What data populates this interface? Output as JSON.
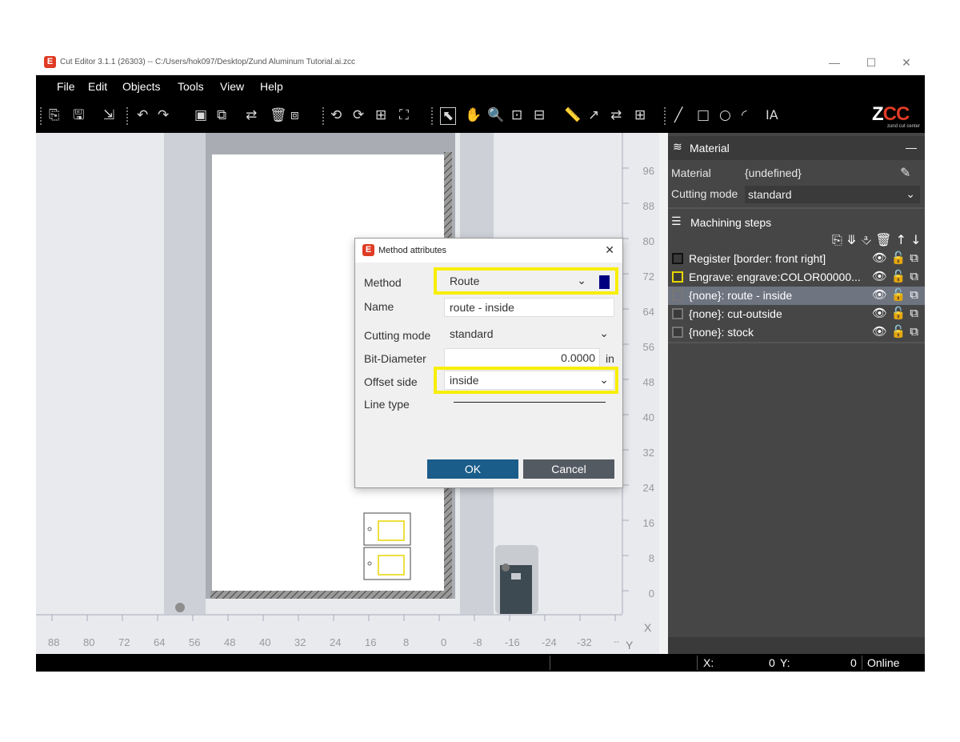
{
  "window": {
    "icon_letter": "E",
    "title": "Cut Editor 3.1.1 (26303)  --  C:/Users/hok097/Desktop/Zund Aluminum Tutorial.ai.zcc",
    "minimize": "—",
    "maximize": "☐",
    "close": "✕"
  },
  "menu": [
    "File",
    "Edit",
    "Objects",
    "Tools",
    "View",
    "Help"
  ],
  "toolbar": {
    "logo": "ZCC",
    "logo_sub": "zund cut center",
    "tools": [
      {
        "name": "import-icon",
        "glyph": "⎘"
      },
      {
        "name": "save-icon",
        "glyph": "🖫"
      },
      {
        "name": "export-icon",
        "glyph": "⇲"
      },
      {
        "name": "undo-icon",
        "glyph": "↶"
      },
      {
        "name": "redo-icon",
        "glyph": "↷"
      },
      {
        "name": "group-icon",
        "glyph": "▣"
      },
      {
        "name": "ungroup-icon",
        "glyph": "⧉"
      },
      {
        "name": "mirror-icon",
        "glyph": "⇄"
      },
      {
        "name": "delete-icon",
        "glyph": "🗑"
      },
      {
        "name": "duplicate-icon",
        "glyph": "⧈"
      },
      {
        "name": "rotate-icon",
        "glyph": "⟲"
      },
      {
        "name": "node-icon",
        "glyph": "⟳"
      },
      {
        "name": "arrange-icon",
        "glyph": "⊞"
      },
      {
        "name": "fit-icon",
        "glyph": "⛶"
      },
      {
        "name": "pointer-icon",
        "glyph": "⬉"
      },
      {
        "name": "hand-icon",
        "glyph": "✋"
      },
      {
        "name": "zoom-icon",
        "glyph": "🔍"
      },
      {
        "name": "zoom-fit-icon",
        "glyph": "⊡"
      },
      {
        "name": "zoom-width-icon",
        "glyph": "⊟"
      },
      {
        "name": "measure-icon",
        "glyph": "📏"
      },
      {
        "name": "direction-icon",
        "glyph": "↗"
      },
      {
        "name": "swap-icon",
        "glyph": "⇄"
      },
      {
        "name": "layout-icon",
        "glyph": "⊞"
      },
      {
        "name": "line-tool-icon",
        "glyph": "╱"
      },
      {
        "name": "rect-tool-icon",
        "glyph": "□"
      },
      {
        "name": "ellipse-tool-icon",
        "glyph": "○"
      },
      {
        "name": "arc-tool-icon",
        "glyph": "◜"
      },
      {
        "name": "text-tool-icon",
        "glyph": "IA"
      }
    ]
  },
  "canvas": {
    "v_ruler": [
      "96",
      "88",
      "80",
      "72",
      "64",
      "56",
      "48",
      "40",
      "32",
      "24",
      "16",
      "8",
      "0"
    ],
    "h_ruler": [
      "88",
      "80",
      "72",
      "64",
      "56",
      "48",
      "40",
      "32",
      "24",
      "16",
      "8",
      "0",
      "-8",
      "-16",
      "-24",
      "-32",
      "--"
    ],
    "x_axis": "X",
    "y_axis": "Y"
  },
  "panel": {
    "material_header": "Material",
    "collapse": "—",
    "material_label": "Material",
    "material_value": "{undefined}",
    "cutting_mode_label": "Cutting mode",
    "cutting_mode_value": "standard",
    "machining_header": "Machining steps",
    "step_tools": "⎘ ⤋ ⎀ 🗑 ↑ ↓ ⎘",
    "steps": [
      {
        "label": "Register [border: front right]",
        "color": "#111111"
      },
      {
        "label": "Engrave: engrave:COLOR00000...",
        "color": "#e8d600"
      },
      {
        "label": "{none}: route - inside",
        "color": "#777777"
      },
      {
        "label": "{none}: cut-outside",
        "color": "#777777"
      },
      {
        "label": "{none}: stock",
        "color": "#777777"
      }
    ]
  },
  "status": {
    "x_label": "X:",
    "x_value": "0",
    "y_label": "Y:",
    "y_value": "0",
    "connection": "Online"
  },
  "dialog": {
    "icon_letter": "E",
    "title": "Method attributes",
    "close": "✕",
    "method_label": "Method",
    "method_value": "Route",
    "method_color": "#000080",
    "name_label": "Name",
    "name_value": "route - inside",
    "cutting_mode_label": "Cutting mode",
    "cutting_mode_value": "standard",
    "bit_diameter_label": "Bit-Diameter",
    "bit_diameter_value": "0.0000",
    "bit_diameter_unit": "in",
    "offset_label": "Offset side",
    "offset_value": "inside",
    "line_type_label": "Line type",
    "ok": "OK",
    "cancel": "Cancel"
  }
}
